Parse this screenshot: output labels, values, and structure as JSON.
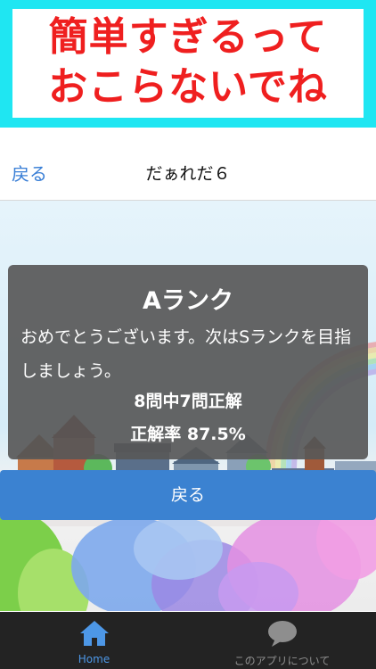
{
  "banner": {
    "line1": "簡単すぎるって",
    "line2": "おこらないでね"
  },
  "nav": {
    "back_label": "戻る",
    "title": "だぁれだ６"
  },
  "dialog": {
    "rank": "Aランク",
    "message": "おめでとうございます。次はSランクを目指しましょう。",
    "score": "8問中7問正解",
    "rate": "正解率 87.5%"
  },
  "action": {
    "back_label": "戻る"
  },
  "tabs": [
    {
      "label": "Home",
      "icon": "home-icon",
      "active": true
    },
    {
      "label": "このアプリについて",
      "icon": "speech-bubble-icon",
      "active": false
    }
  ],
  "colors": {
    "banner_bg": "#1fe6f2",
    "banner_text": "#ef1f1f",
    "link_blue": "#3a7fd6",
    "button_blue": "#3b82d1",
    "tab_active": "#4d97e6"
  }
}
